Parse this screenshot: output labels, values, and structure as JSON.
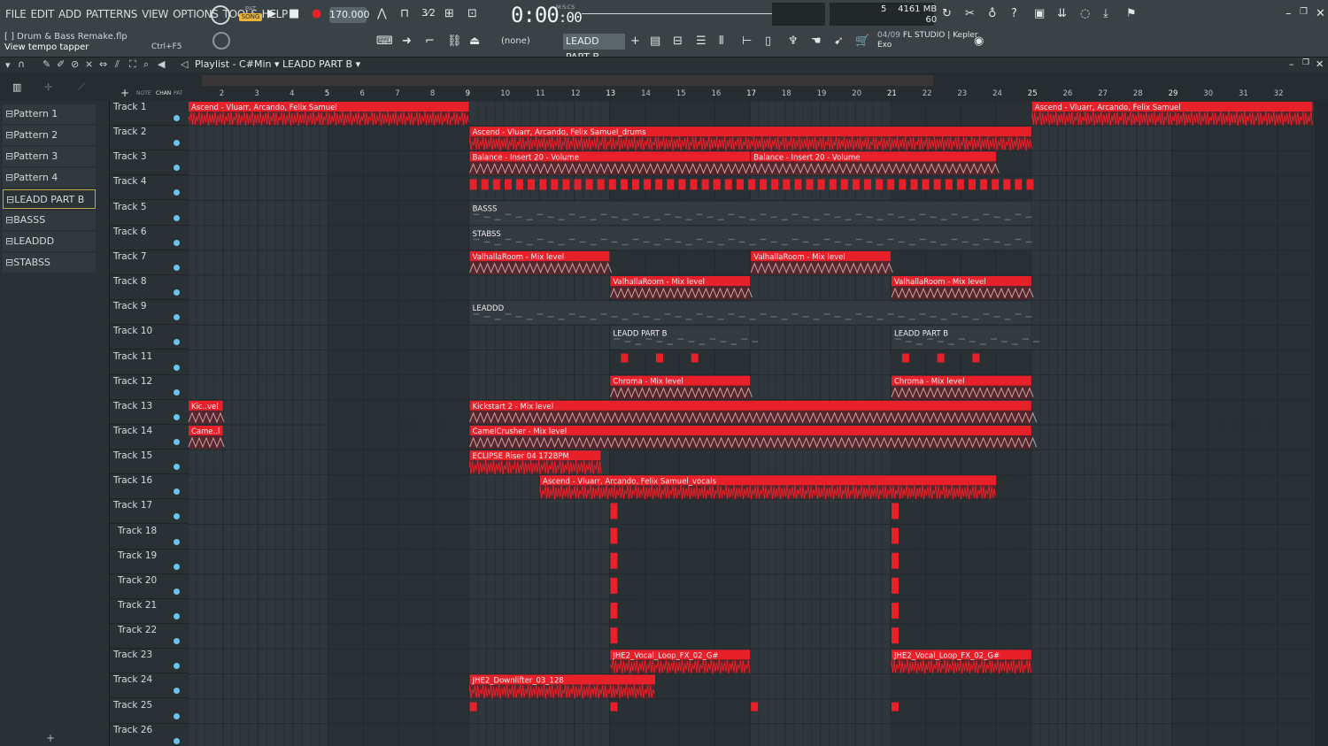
{
  "menu": [
    "FILE",
    "EDIT",
    "ADD",
    "PATTERNS",
    "VIEW",
    "OPTIONS",
    "TOOLS",
    "HELP"
  ],
  "transport": {
    "pat_label": "PAT",
    "song_label": "SONG",
    "tempo": "170.000",
    "time": "0:00",
    "time_fraction": ":00",
    "time_mode": "M:S:CS"
  },
  "project": {
    "filename": "[ ] Drum & Bass Remake.flp",
    "hint": "View tempo tapper",
    "hint_key": "Ctrl+F5"
  },
  "stats": {
    "cpu_value": "5",
    "memory": "4161 MB",
    "polyphony": "60"
  },
  "toolbar2": {
    "none_select": "(none)",
    "pattern_select": "LEADD PART B"
  },
  "news": {
    "date": "04/09",
    "text": "FL STUDIO | Kepler",
    "text2": "Exo"
  },
  "playlist": {
    "title": "Playlist - C#Min",
    "breadcrumb": "LEADD PART B",
    "picker_tabs": [
      "NOTE",
      "CHAN",
      "PAT"
    ],
    "patterns": [
      "Pattern 1",
      "Pattern 2",
      "Pattern 3",
      "Pattern 4",
      "LEADD PART B",
      "BASSS",
      "LEADDD",
      "STABSS"
    ],
    "selected_pattern": "LEADD PART B",
    "bars": [
      "2",
      "3",
      "4",
      "5",
      "6",
      "7",
      "8",
      "9",
      "10",
      "11",
      "12",
      "13",
      "14",
      "15",
      "16",
      "17",
      "18",
      "19",
      "20",
      "21",
      "22",
      "23",
      "24",
      "25",
      "26",
      "27",
      "28",
      "29",
      "30",
      "31",
      "32"
    ],
    "tracks": [
      "Track 1",
      "Track 2",
      "Track 3",
      "Track 4",
      "Track 5",
      "Track 6",
      "Track 7",
      "Track 8",
      "Track 9",
      "Track 10",
      "Track 11",
      "Track 12",
      "Track 13",
      "Track 14",
      "Track 15",
      "Track 16",
      "Track 17",
      "Track 18",
      "Track 19",
      "Track 20",
      "Track 21",
      "Track 22",
      "Track 23",
      "Track 24",
      "Track 25",
      "Track 26"
    ]
  },
  "clips": [
    {
      "track": 1,
      "bar": 1,
      "len": 8,
      "label": "Ascend - Vluarr, Arcando, Felix Samuel",
      "kind": "audio"
    },
    {
      "track": 1,
      "bar": 25,
      "len": 8,
      "label": "Ascend - Vluarr, Arcando, Felix Samuel",
      "kind": "audio"
    },
    {
      "track": 2,
      "bar": 9,
      "len": 16,
      "label": "Ascend - Vluarr, Arcando, Felix Samuel_drums",
      "kind": "audio"
    },
    {
      "track": 3,
      "bar": 9,
      "len": 8,
      "label": "Balance - Insert 20 - Volume",
      "kind": "auto"
    },
    {
      "track": 3,
      "bar": 17,
      "len": 7,
      "label": "Balance - Insert 20 - Volume",
      "kind": "auto"
    },
    {
      "track": 5,
      "bar": 9,
      "len": 16,
      "label": "BASSS",
      "kind": "pattern"
    },
    {
      "track": 6,
      "bar": 9,
      "len": 16,
      "label": "STABSS",
      "kind": "pattern"
    },
    {
      "track": 7,
      "bar": 9,
      "len": 4,
      "label": "ValhallaRoom - Mix level",
      "kind": "auto"
    },
    {
      "track": 7,
      "bar": 17,
      "len": 4,
      "label": "ValhallaRoom - Mix level",
      "kind": "auto"
    },
    {
      "track": 8,
      "bar": 13,
      "len": 4,
      "label": "ValhallaRoom - Mix level",
      "kind": "auto"
    },
    {
      "track": 8,
      "bar": 21,
      "len": 4,
      "label": "ValhallaRoom - Mix level",
      "kind": "auto"
    },
    {
      "track": 9,
      "bar": 9,
      "len": 16,
      "label": "LEADDD",
      "kind": "pattern"
    },
    {
      "track": 10,
      "bar": 13,
      "len": 4,
      "label": "LEADD PART B",
      "kind": "pattern"
    },
    {
      "track": 10,
      "bar": 21,
      "len": 4,
      "label": "LEADD PART B",
      "kind": "pattern"
    },
    {
      "track": 12,
      "bar": 13,
      "len": 4,
      "label": "Chroma - Mix level",
      "kind": "auto"
    },
    {
      "track": 12,
      "bar": 21,
      "len": 4,
      "label": "Chroma - Mix level",
      "kind": "auto"
    },
    {
      "track": 13,
      "bar": 1,
      "len": 1,
      "label": "Kic..vel",
      "kind": "auto"
    },
    {
      "track": 13,
      "bar": 9,
      "len": 16,
      "label": "Kickstart 2 - Mix level",
      "kind": "auto"
    },
    {
      "track": 14,
      "bar": 1,
      "len": 1,
      "label": "Came..l",
      "kind": "auto"
    },
    {
      "track": 14,
      "bar": 9,
      "len": 16,
      "label": "CamelCrusher - Mix level",
      "kind": "auto"
    },
    {
      "track": 15,
      "bar": 9,
      "len": 3.75,
      "label": "ECLIPSE Riser 04 172BPM",
      "kind": "audio"
    },
    {
      "track": 16,
      "bar": 11,
      "len": 13,
      "label": "Ascend - Vluarr, Arcando, Felix Samuel_vocals",
      "kind": "audio"
    },
    {
      "track": 23,
      "bar": 13,
      "len": 4,
      "label": "JHE2_Vocal_Loop_FX_02_G#",
      "kind": "audio"
    },
    {
      "track": 23,
      "bar": 21,
      "len": 4,
      "label": "JHE2_Vocal_Loop_FX_02_G#",
      "kind": "audio"
    },
    {
      "track": 24,
      "bar": 9,
      "len": 5.3,
      "label": "JHE2_Downlifter_03_128",
      "kind": "audio"
    }
  ],
  "colors": {
    "clip": "#e8202a",
    "clip_dark": "#7a1a1f",
    "grid_bg": "#2c3338",
    "accent": "#c7a94a"
  }
}
